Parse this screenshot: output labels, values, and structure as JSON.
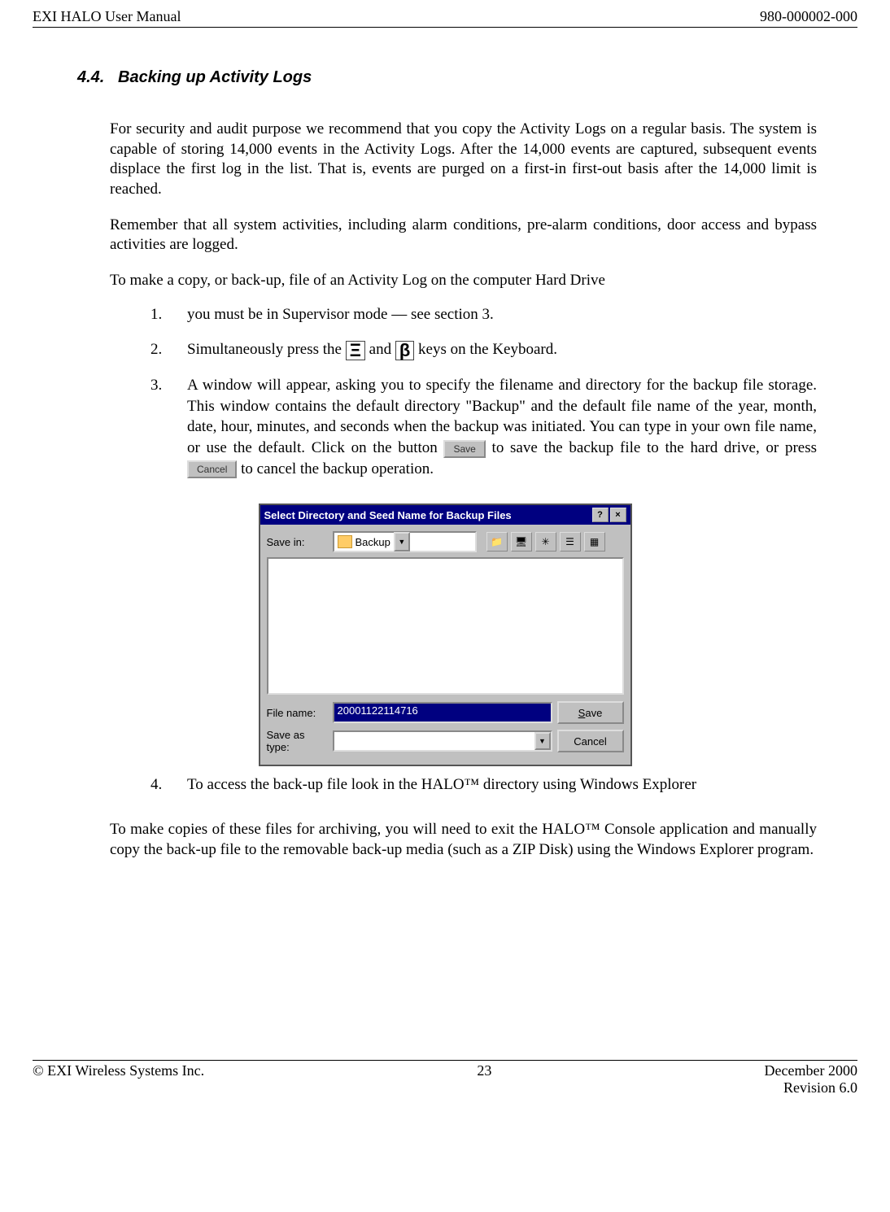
{
  "header": {
    "left": "EXI HALO User Manual",
    "right": "980-000002-000"
  },
  "section": {
    "number": "4.4.",
    "title": "Backing up Activity Logs"
  },
  "paragraphs": {
    "p1": "For security and audit purpose we recommend that you copy the Activity Logs on a regular basis. The system is capable of storing 14,000 events in the Activity Logs. After the 14,000 events are captured, subsequent events displace the first log in the list.  That is, events are purged on a first-in first-out basis after the 14,000 limit is reached.",
    "p2": "Remember that all system activities, including alarm conditions, pre-alarm conditions, door access and bypass activities are logged.",
    "p3": "To make a copy, or back-up, file of an Activity Log on the computer Hard Drive",
    "p4": "To make copies of these files for archiving, you will need to exit the HALO™ Console application and manually copy the back-up file to the removable back-up media (such as a ZIP Disk) using the Windows Explorer program."
  },
  "steps": {
    "s1_num": "1.",
    "s1": " you must be in Supervisor mode — see section 3.",
    "s2_num": "2.",
    "s2_a": "Simultaneously press the ",
    "s2_key1": "Ξ",
    "s2_and": " and ",
    "s2_key2": "β",
    "s2_b": " keys on the Keyboard.",
    "s3_num": "3.",
    "s3_a": "A window will appear, asking you to specify the filename and directory for the backup file storage. This window contains the default directory \"Backup\" and the default file name of the year, month, date, hour, minutes, and seconds when the backup was initiated.  You can type in your own file name, or use the default.  Click on the button ",
    "s3_save_btn": "Save",
    "s3_b": " to save the backup file to the hard drive, or press ",
    "s3_cancel_btn": "Cancel",
    "s3_c": " to cancel the backup operation.",
    "s4_num": "4.",
    "s4": "To access the back-up file look in the HALO™ directory using Windows Explorer"
  },
  "dialog": {
    "title": "Select Directory and Seed Name for Backup Files",
    "help_btn": "?",
    "close_btn": "×",
    "savein_label": "Save in:",
    "folder": "Backup",
    "filename_label": "File name:",
    "filename_value": "20001122114716",
    "saveastype_label": "Save as type:",
    "saveastype_value": "",
    "save_btn_u": "S",
    "save_btn_rest": "ave",
    "cancel_btn": "Cancel"
  },
  "footer": {
    "left": "© EXI Wireless Systems Inc.",
    "center": "23",
    "right_line1": "December 2000",
    "right_line2": "Revision 6.0"
  }
}
